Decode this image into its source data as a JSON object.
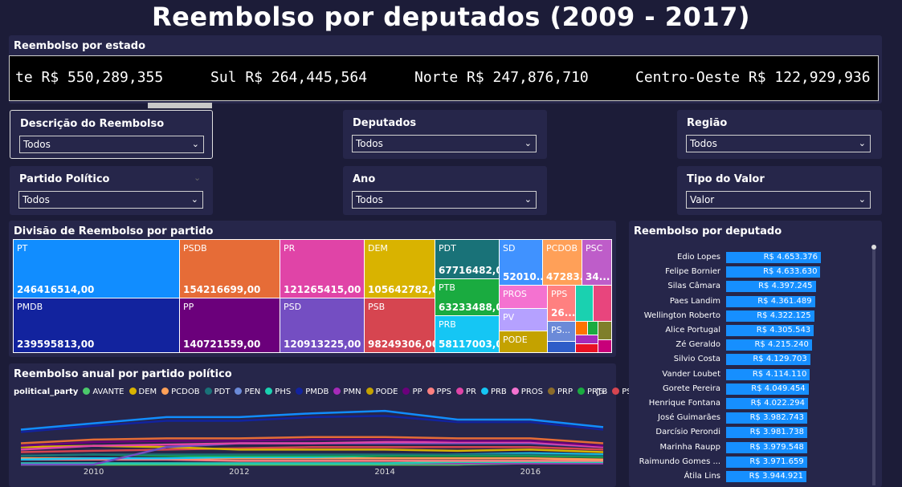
{
  "header": {
    "title": "Reembolso por deputados (2009 - 2017)"
  },
  "ticker": {
    "title": "Reembolso por estado",
    "items": [
      "te R$ 550,289,355",
      "Sul R$ 264,445,564",
      "Norte R$ 247,876,710",
      "Centro-Oeste R$ 122,929,936"
    ]
  },
  "filters": [
    {
      "label": "Descrição do Reembolso",
      "value": "Todos"
    },
    {
      "label": "Deputados",
      "value": "Todos"
    },
    {
      "label": "Região",
      "value": "Todos"
    },
    {
      "label": "Partido Político",
      "value": "Todos"
    },
    {
      "label": "Ano",
      "value": "Todos"
    },
    {
      "label": "Tipo do Valor",
      "value": "Valor"
    }
  ],
  "treemap": {
    "title": "Divisão de Reembolso por partido",
    "cells": [
      {
        "name": "PT",
        "value": "246416514,00",
        "color": "#118dff"
      },
      {
        "name": "PMDB",
        "value": "239595813,00",
        "color": "#12239e"
      },
      {
        "name": "PSDB",
        "value": "154216699,00",
        "color": "#e66c37"
      },
      {
        "name": "PP",
        "value": "140721559,00",
        "color": "#6b007b"
      },
      {
        "name": "PR",
        "value": "121265415,00",
        "color": "#e044a7"
      },
      {
        "name": "PSD",
        "value": "120913225,00",
        "color": "#744ec2"
      },
      {
        "name": "DEM",
        "value": "105642782,00",
        "color": "#d9b300"
      },
      {
        "name": "PSB",
        "value": "98249306,00",
        "color": "#d64550"
      },
      {
        "name": "PDT",
        "value": "67716482,00",
        "color": "#197278"
      },
      {
        "name": "PTB",
        "value": "63233488,00",
        "color": "#1aab40"
      },
      {
        "name": "PRB",
        "value": "58117003,00",
        "color": "#15c6f4"
      },
      {
        "name": "SD",
        "value": "52010...",
        "color": "#4092ff"
      },
      {
        "name": "PCDOB",
        "value": "47283...",
        "color": "#ffa058"
      },
      {
        "name": "PSC",
        "value": "34...",
        "color": "#be5dc9"
      },
      {
        "name": "PROS",
        "value": "",
        "color": "#f472d0"
      },
      {
        "name": "PV",
        "value": "",
        "color": "#b5a1ff"
      },
      {
        "name": "PODE",
        "value": "",
        "color": "#c4a200"
      },
      {
        "name": "PPS",
        "value": "26...",
        "color": "#ff8080"
      },
      {
        "name": "PS...",
        "value": "",
        "color": "#6b8ad8"
      }
    ]
  },
  "line_chart": {
    "title": "Reembolso anual por partido político",
    "legend_title": "political_party",
    "series_legend": [
      {
        "name": "AVANTE",
        "color": "#4bc96b"
      },
      {
        "name": "DEM",
        "color": "#d9b300"
      },
      {
        "name": "PCDOB",
        "color": "#ffa058"
      },
      {
        "name": "PDT",
        "color": "#197278"
      },
      {
        "name": "PEN",
        "color": "#6b8ad8"
      },
      {
        "name": "PHS",
        "color": "#1ad1b0"
      },
      {
        "name": "PMDB",
        "color": "#12239e"
      },
      {
        "name": "PMN",
        "color": "#a62ab8"
      },
      {
        "name": "PODE",
        "color": "#c4a200"
      },
      {
        "name": "PP",
        "color": "#6b007b"
      },
      {
        "name": "PPS",
        "color": "#ff8080"
      },
      {
        "name": "PR",
        "color": "#e044a7"
      },
      {
        "name": "PRB",
        "color": "#15c6f4"
      },
      {
        "name": "PROS",
        "color": "#f472d0"
      },
      {
        "name": "PRP",
        "color": "#8b6b2a"
      },
      {
        "name": "PRTB",
        "color": "#1aab40"
      },
      {
        "name": "PSB",
        "color": "#d64550"
      }
    ],
    "x_ticks": [
      "2010",
      "2012",
      "2014",
      "2016"
    ]
  },
  "chart_data": {
    "type": "line",
    "x": [
      2009,
      2010,
      2011,
      2012,
      2013,
      2014,
      2015,
      2016,
      2017
    ],
    "series": [
      {
        "name": "PT",
        "color": "#118dff",
        "values": [
          28,
          33,
          38,
          38,
          41,
          43,
          36,
          36,
          30
        ]
      },
      {
        "name": "PMDB",
        "color": "#12239e",
        "values": [
          26,
          31,
          35,
          35,
          38,
          39,
          34,
          34,
          28
        ]
      },
      {
        "name": "PSDB",
        "color": "#e66c37",
        "values": [
          17,
          20,
          21,
          21,
          22,
          22,
          21,
          21,
          17
        ]
      },
      {
        "name": "PP",
        "color": "#6b007b",
        "values": [
          15,
          18,
          19,
          19,
          20,
          20,
          19,
          19,
          15
        ]
      },
      {
        "name": "PR",
        "color": "#e044a7",
        "values": [
          12,
          15,
          16,
          17,
          17,
          18,
          18,
          18,
          14
        ]
      },
      {
        "name": "PSD",
        "color": "#744ec2",
        "values": [
          0,
          0,
          14,
          17,
          17,
          17,
          17,
          17,
          14
        ]
      },
      {
        "name": "DEM",
        "color": "#d9b300",
        "values": [
          14,
          15,
          14,
          12,
          12,
          12,
          11,
          12,
          10
        ]
      },
      {
        "name": "PSB",
        "color": "#d64550",
        "values": [
          10,
          11,
          12,
          13,
          14,
          14,
          14,
          14,
          12
        ]
      },
      {
        "name": "PDT",
        "color": "#197278",
        "values": [
          7,
          8,
          8,
          8,
          8,
          8,
          8,
          8,
          7
        ]
      },
      {
        "name": "PTB",
        "color": "#1aab40",
        "values": [
          7,
          8,
          7,
          7,
          7,
          7,
          7,
          7,
          6
        ]
      },
      {
        "name": "PRB",
        "color": "#15c6f4",
        "values": [
          4,
          5,
          5,
          6,
          6,
          7,
          8,
          9,
          8
        ]
      },
      {
        "name": "PCDOB",
        "color": "#ffa058",
        "values": [
          5,
          5,
          5,
          5,
          5,
          5,
          5,
          5,
          4
        ]
      },
      {
        "name": "PPS",
        "color": "#ff8080",
        "values": [
          4,
          4,
          4,
          3,
          3,
          3,
          3,
          3,
          3
        ]
      },
      {
        "name": "PHS",
        "color": "#1ad1b0",
        "values": [
          1,
          1,
          1,
          1,
          1,
          1,
          2,
          2,
          2
        ]
      },
      {
        "name": "PMN",
        "color": "#a62ab8",
        "values": [
          1,
          1,
          1,
          1,
          1,
          1,
          1,
          1,
          1
        ]
      },
      {
        "name": "AVANTE",
        "color": "#4bc96b",
        "values": [
          0,
          0,
          0,
          0,
          0,
          0,
          0,
          1,
          1
        ]
      },
      {
        "name": "PODE",
        "color": "#c4a200",
        "values": [
          0,
          0,
          0,
          0,
          0,
          0,
          0,
          2,
          2
        ]
      }
    ]
  },
  "bar_chart": {
    "title": "Reembolso por deputado",
    "rows": [
      {
        "name": "Edio Lopes",
        "label": "R$ 4.653.376",
        "value": 4653376
      },
      {
        "name": "Felipe Bornier",
        "label": "R$ 4.633.630",
        "value": 4633630
      },
      {
        "name": "Silas Câmara",
        "label": "R$ 4.397.245",
        "value": 4397245
      },
      {
        "name": "Paes Landim",
        "label": "R$ 4.361.489",
        "value": 4361489
      },
      {
        "name": "Wellington Roberto",
        "label": "R$ 4.322.125",
        "value": 4322125
      },
      {
        "name": "Alice Portugal",
        "label": "R$ 4.305.543",
        "value": 4305543
      },
      {
        "name": "Zé Geraldo",
        "label": "R$ 4.215.240",
        "value": 4215240
      },
      {
        "name": "Silvio Costa",
        "label": "R$ 4.129.703",
        "value": 4129703
      },
      {
        "name": "Vander Loubet",
        "label": "R$ 4.114.110",
        "value": 4114110
      },
      {
        "name": "Gorete Pereira",
        "label": "R$ 4.049.454",
        "value": 4049454
      },
      {
        "name": "Henrique Fontana",
        "label": "R$ 4.022.294",
        "value": 4022294
      },
      {
        "name": "José Guimarães",
        "label": "R$ 3.982.743",
        "value": 3982743
      },
      {
        "name": "Darcísio Perondi",
        "label": "R$ 3.981.738",
        "value": 3981738
      },
      {
        "name": "Marinha Raupp",
        "label": "R$ 3.979.548",
        "value": 3979548
      },
      {
        "name": "Raimundo Gomes ...",
        "label": "R$ 3.971.659",
        "value": 3971659
      },
      {
        "name": "Átila Lins",
        "label": "R$ 3.944.921",
        "value": 3944921
      }
    ]
  }
}
